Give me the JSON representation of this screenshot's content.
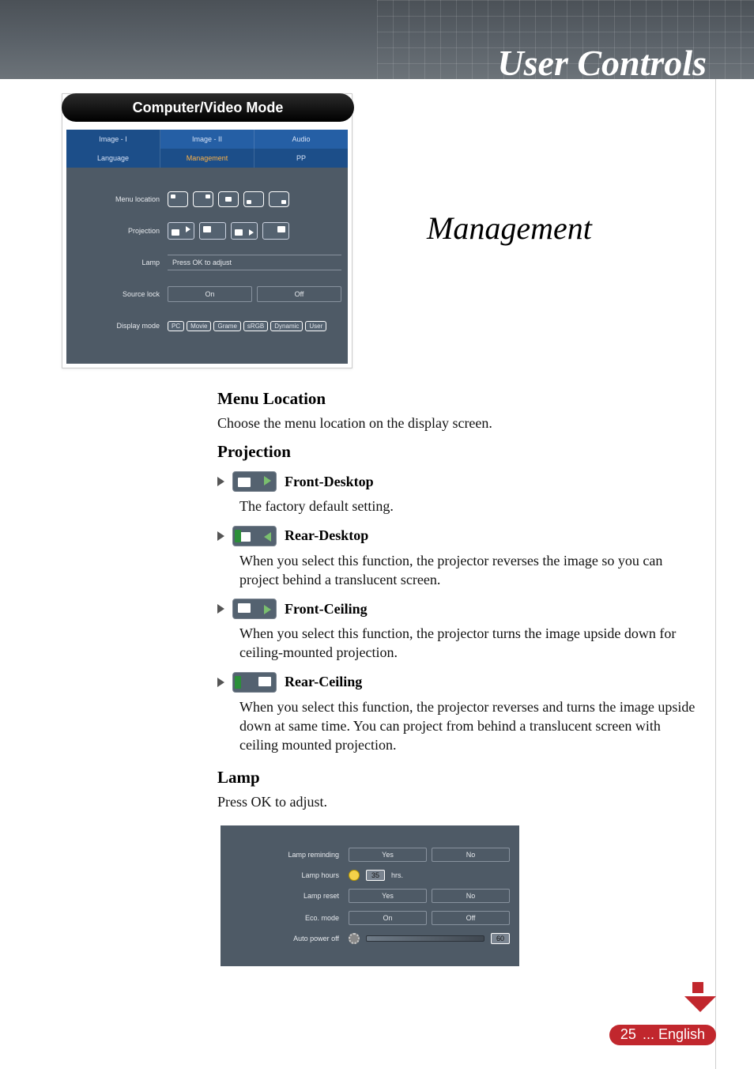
{
  "header": {
    "title": "User Controls"
  },
  "section": {
    "title": "Management"
  },
  "osd": {
    "mode_title": "Computer/Video Mode",
    "tabs_row1": {
      "image1": "Image - I",
      "image2": "Image - II",
      "audio": "Audio"
    },
    "tabs_row2": {
      "language": "Language",
      "management": "Management",
      "pp": "PP"
    },
    "rows": {
      "menu_location": {
        "label": "Menu location"
      },
      "projection": {
        "label": "Projection"
      },
      "lamp": {
        "label": "Lamp",
        "button": "Press OK  to adjust"
      },
      "source_lock": {
        "label": "Source lock",
        "on": "On",
        "off": "Off"
      },
      "display_mode": {
        "label": "Display mode",
        "options": [
          "PC",
          "Movie",
          "Grame",
          "sRGB",
          "Dynamic",
          "User"
        ]
      }
    }
  },
  "body": {
    "menu_location": {
      "heading": "Menu Location",
      "text": "Choose the menu location on the display screen."
    },
    "projection": {
      "heading": "Projection",
      "items": [
        {
          "name": "Front-Desktop",
          "text": "The factory default setting."
        },
        {
          "name": "Rear-Desktop",
          "text": "When you select this function, the projector reverses the image so you can project behind a translucent screen."
        },
        {
          "name": "Front-Ceiling",
          "text": "When you select this function, the projector turns the image upside down for ceiling-mounted projection."
        },
        {
          "name": "Rear-Ceiling",
          "text": "When you select this function, the projector reverses and turns the image upside down at same time. You can project from behind a translucent screen with ceiling mounted projection."
        }
      ]
    },
    "lamp": {
      "heading": "Lamp",
      "text": "Press OK to adjust."
    }
  },
  "lamp_osd": {
    "reminding": {
      "label": "Lamp reminding",
      "yes": "Yes",
      "no": "No"
    },
    "hours": {
      "label": "Lamp hours",
      "value": "35",
      "unit": "hrs."
    },
    "reset": {
      "label": "Lamp reset",
      "yes": "Yes",
      "no": "No"
    },
    "eco": {
      "label": "Eco. mode",
      "on": "On",
      "off": "Off"
    },
    "auto_off": {
      "label": "Auto power off",
      "value": "60"
    }
  },
  "footer": {
    "page": "25",
    "lang": "... English"
  }
}
